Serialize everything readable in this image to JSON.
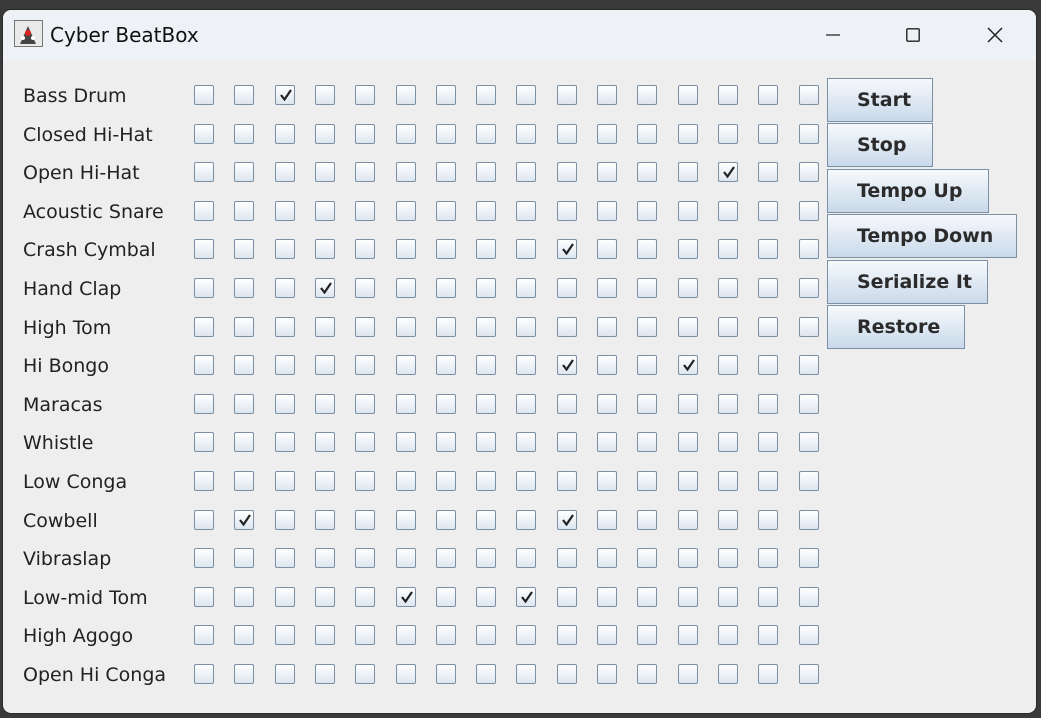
{
  "window": {
    "title": "Cyber BeatBox"
  },
  "instruments": [
    "Bass Drum",
    "Closed Hi-Hat",
    "Open Hi-Hat",
    "Acoustic Snare",
    "Crash Cymbal",
    "Hand Clap",
    "High Tom",
    "Hi Bongo",
    "Maracas",
    "Whistle",
    "Low Conga",
    "Cowbell",
    "Vibraslap",
    "Low-mid Tom",
    "High Agogo",
    "Open Hi Conga"
  ],
  "checked": [
    [
      0,
      2
    ],
    [
      2,
      13
    ],
    [
      4,
      9
    ],
    [
      5,
      3
    ],
    [
      7,
      9
    ],
    [
      7,
      12
    ],
    [
      11,
      1
    ],
    [
      11,
      9
    ],
    [
      13,
      5
    ],
    [
      13,
      8
    ]
  ],
  "buttons": {
    "start": "Start",
    "stop": "Stop",
    "tempo_up": "Tempo Up",
    "tempo_down": "Tempo Down",
    "serialize": "Serialize It",
    "restore": "Restore"
  }
}
